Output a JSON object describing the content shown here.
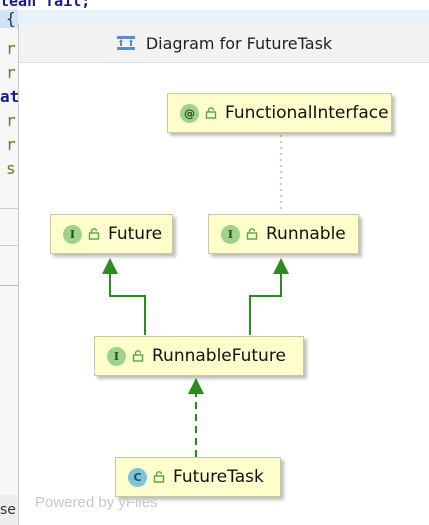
{
  "window": {
    "title": "Diagram for FutureTask"
  },
  "editor": {
    "top_text": "tean fail;",
    "lines": [
      "{",
      "r",
      "r",
      "at",
      "r",
      "r",
      "s"
    ],
    "bottom_text": "se"
  },
  "diagram": {
    "nodes": [
      {
        "name": "FunctionalInterface",
        "kind": "annotation",
        "badge": "@"
      },
      {
        "name": "Future",
        "kind": "interface",
        "badge": "I"
      },
      {
        "name": "Runnable",
        "kind": "interface",
        "badge": "I"
      },
      {
        "name": "RunnableFuture",
        "kind": "interface",
        "badge": "I"
      },
      {
        "name": "FutureTask",
        "kind": "class",
        "badge": "C"
      }
    ]
  },
  "watermark": "Powered by yFiles",
  "colors": {
    "node_fill": "#fefecc",
    "edge_green": "#2e8b1e",
    "interface_badge": "#9fd28a",
    "class_badge": "#7cc4d8"
  }
}
